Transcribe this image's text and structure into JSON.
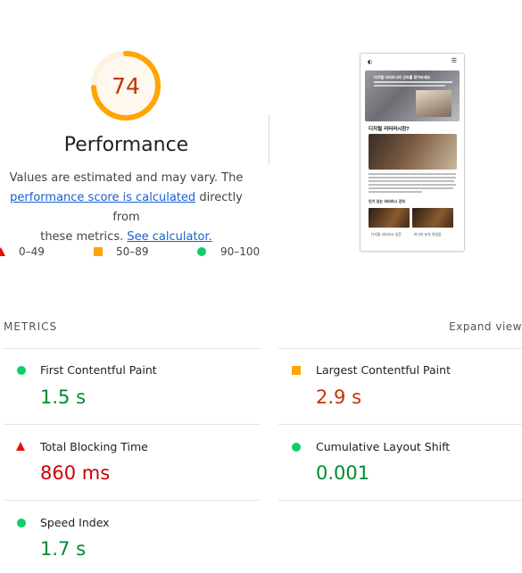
{
  "score": {
    "value": "74",
    "fraction": 0.74,
    "colors": {
      "arc": "#ffa400",
      "track": "#fff1de",
      "fill": "#fff8ee",
      "text": "#c33300"
    }
  },
  "performance": {
    "title": "Performance",
    "desc_1": "Values are estimated and may vary. The",
    "link_score": "performance score is calculated",
    "desc_2": "directly from",
    "desc_3": "these metrics.",
    "link_calc": "See calculator."
  },
  "legend": [
    {
      "label": "0–49",
      "icon": "fail-triangle-icon",
      "color": "#eb0f00"
    },
    {
      "label": "50–89",
      "icon": "average-square-icon",
      "color": "#ffa400"
    },
    {
      "label": "90–100",
      "icon": "pass-circle-icon",
      "color": "#0cce6b"
    }
  ],
  "screenshot": {
    "hero_text": "디지털 리터러시의 산타를 찾아보세요",
    "section_title": "디지털 리터러시란?",
    "list_title": "인기 있는 리터러시 강의",
    "captions": [
      "디지털 리터러시 입문",
      "미디어 분석 첫걸음"
    ]
  },
  "metrics": {
    "heading": "METRICS",
    "expand": "Expand view",
    "items": [
      {
        "name": "First Contentful Paint",
        "value": "1.5 s",
        "status": "pass"
      },
      {
        "name": "Largest Contentful Paint",
        "value": "2.9 s",
        "status": "average"
      },
      {
        "name": "Total Blocking Time",
        "value": "860 ms",
        "status": "fail"
      },
      {
        "name": "Cumulative Layout Shift",
        "value": "0.001",
        "status": "pass"
      },
      {
        "name": "Speed Index",
        "value": "1.7 s",
        "status": "pass"
      }
    ]
  }
}
